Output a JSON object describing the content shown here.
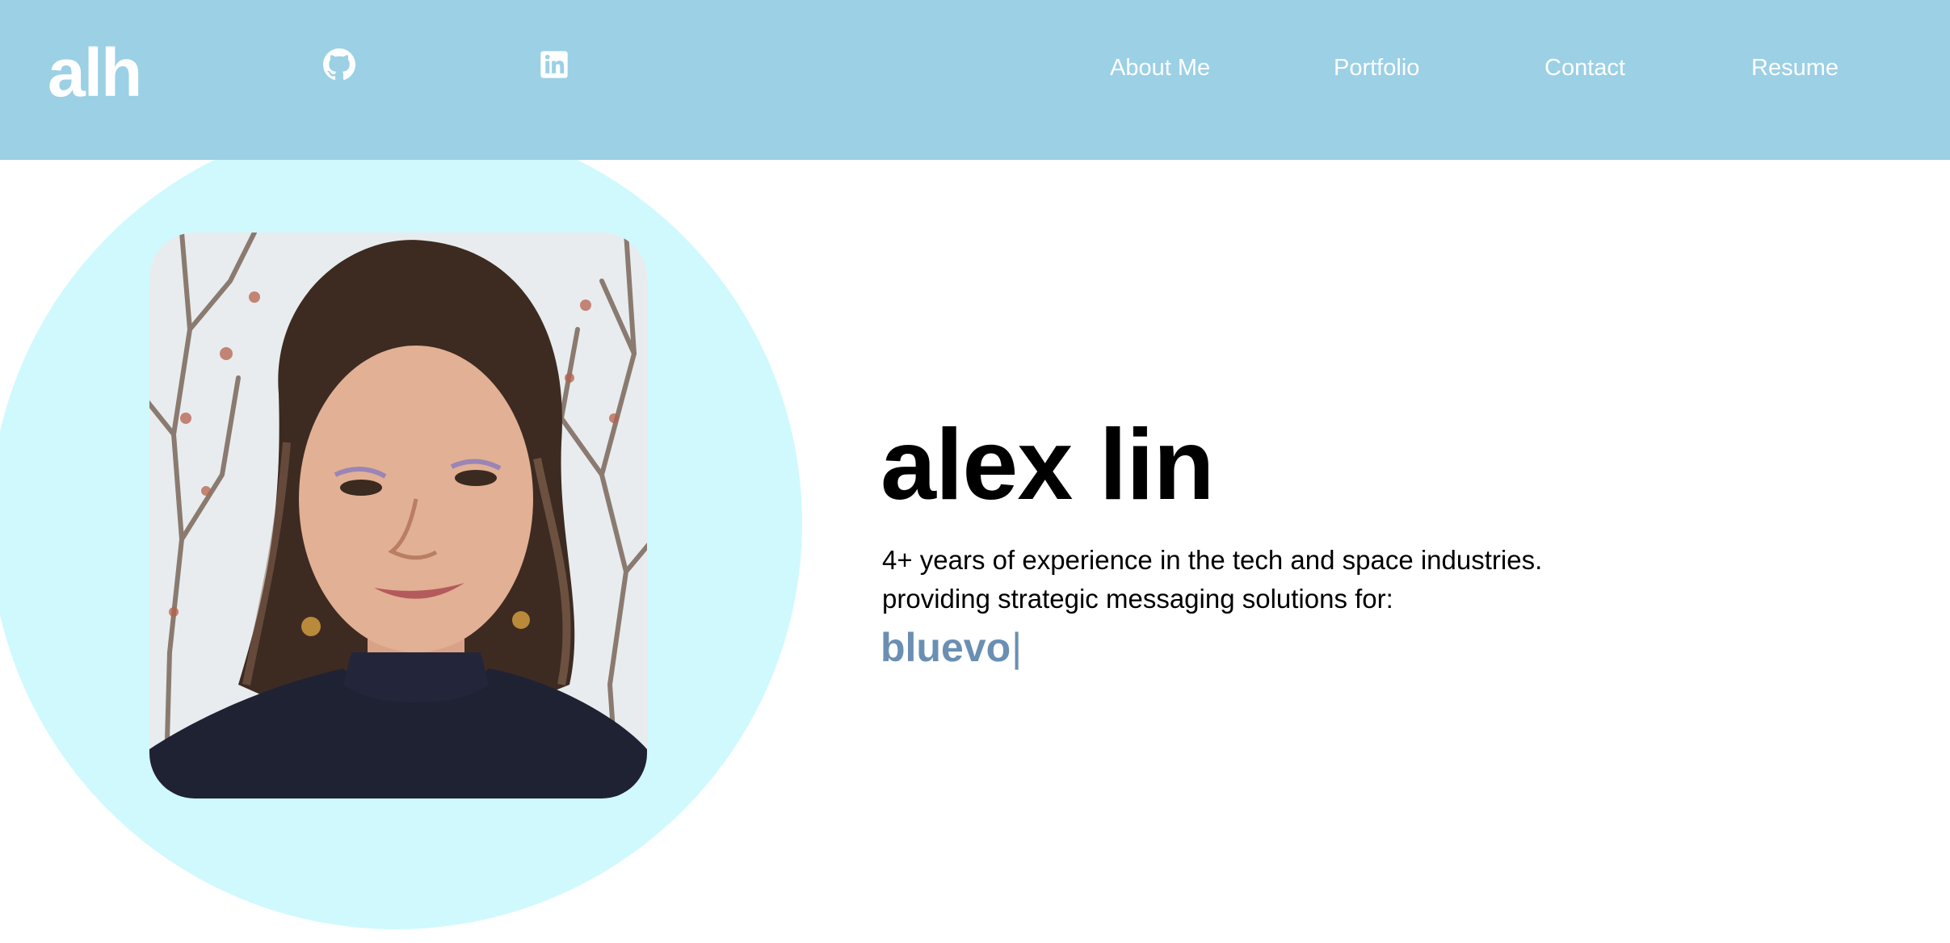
{
  "header": {
    "logo": "alh",
    "background_color": "#9bd0e5",
    "social": [
      {
        "name": "github",
        "icon": "github-icon"
      },
      {
        "name": "linkedin",
        "icon": "linkedin-icon"
      }
    ],
    "nav": [
      {
        "label": "About Me"
      },
      {
        "label": "Portfolio"
      },
      {
        "label": "Contact"
      },
      {
        "label": "Resume"
      }
    ]
  },
  "hero": {
    "circle_color": "#cff9fd",
    "name": "alex lin",
    "tagline_line1": "4+ years of experience in the tech and space industries.",
    "tagline_line2": "providing strategic messaging solutions for:",
    "typed_text": "bluevo",
    "cursor": "|",
    "typed_color": "#6a8fb3"
  }
}
